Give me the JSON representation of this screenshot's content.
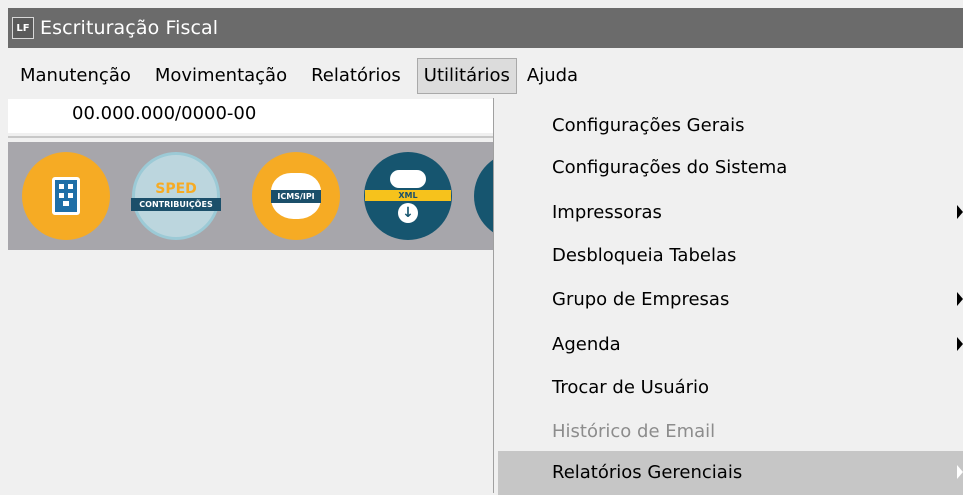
{
  "window": {
    "icon_text": "LF",
    "title": "Escrituração Fiscal"
  },
  "menubar": {
    "items": [
      {
        "label": "Manutenção"
      },
      {
        "label": "Movimentação"
      },
      {
        "label": "Relatórios"
      },
      {
        "label": "Utilitários",
        "active": true
      },
      {
        "label": "Ajuda"
      }
    ]
  },
  "company": {
    "cnpj": "00.000.000/0000-00"
  },
  "toolbar": {
    "buttons": [
      {
        "icon": "building-icon"
      },
      {
        "icon": "sped-contribuicoes-icon",
        "top_text": "SPED",
        "ribbon_text": "CONTRIBUIÇÕES"
      },
      {
        "icon": "icms-ipi-icon",
        "ribbon_text": "ICMS/IPI"
      },
      {
        "icon": "xml-download-icon",
        "ribbon_text": "XML"
      },
      {
        "icon": "partial-icon"
      }
    ]
  },
  "dropdown": {
    "items": [
      {
        "label": "Configurações Gerais",
        "submenu": false,
        "disabled": false
      },
      {
        "label": "Configurações do Sistema",
        "submenu": false,
        "disabled": false
      },
      {
        "label": "Impressoras",
        "submenu": true,
        "disabled": false
      },
      {
        "label": "Desbloqueia Tabelas",
        "submenu": false,
        "disabled": false
      },
      {
        "label": "Grupo de Empresas",
        "submenu": true,
        "disabled": false
      },
      {
        "label": "Agenda",
        "submenu": true,
        "disabled": false
      },
      {
        "label": "Trocar de Usuário",
        "submenu": false,
        "disabled": false
      },
      {
        "label": "Histórico de Email",
        "submenu": false,
        "disabled": true
      },
      {
        "label": "Relatórios Gerenciais",
        "submenu": true,
        "disabled": false,
        "highlighted": true
      }
    ]
  },
  "colors": {
    "titlebar": "#6b6b6b",
    "toolbar_bg": "#a7a6ab",
    "accent_orange": "#f6ab24",
    "accent_navy": "#16556f",
    "highlight": "#c6c6c6"
  }
}
